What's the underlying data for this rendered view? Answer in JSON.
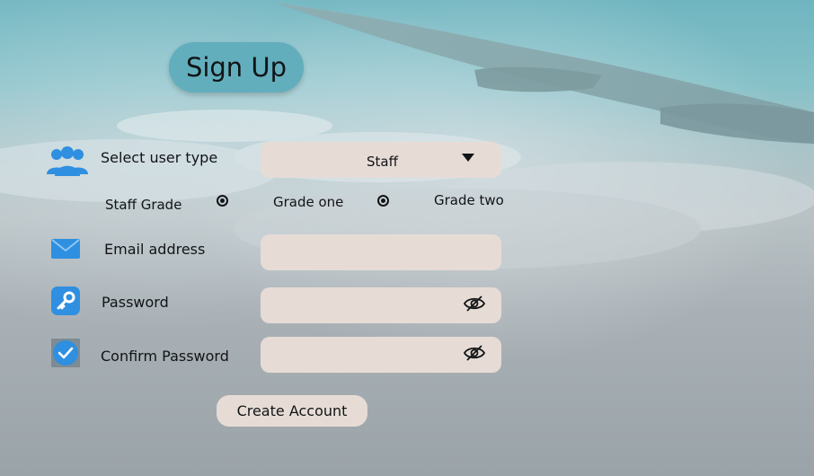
{
  "title": "Sign Up",
  "user_type": {
    "label": "Select user type",
    "selected": "Staff"
  },
  "staff_grade": {
    "label": "Staff Grade",
    "options": [
      "Grade one",
      "Grade two"
    ]
  },
  "email": {
    "label": "Email address",
    "value": ""
  },
  "password": {
    "label": "Password",
    "value": ""
  },
  "confirm_password": {
    "label": "Confirm Password",
    "value": ""
  },
  "create_button": "Create Account",
  "colors": {
    "title_pill": "#63aebc",
    "field_bg": "#e6dcd5",
    "icon_blue": "#2f8fe0"
  },
  "icons": [
    "users-icon",
    "mail-icon",
    "key-icon",
    "check-icon",
    "eye-off-icon",
    "caret-down-icon"
  ]
}
